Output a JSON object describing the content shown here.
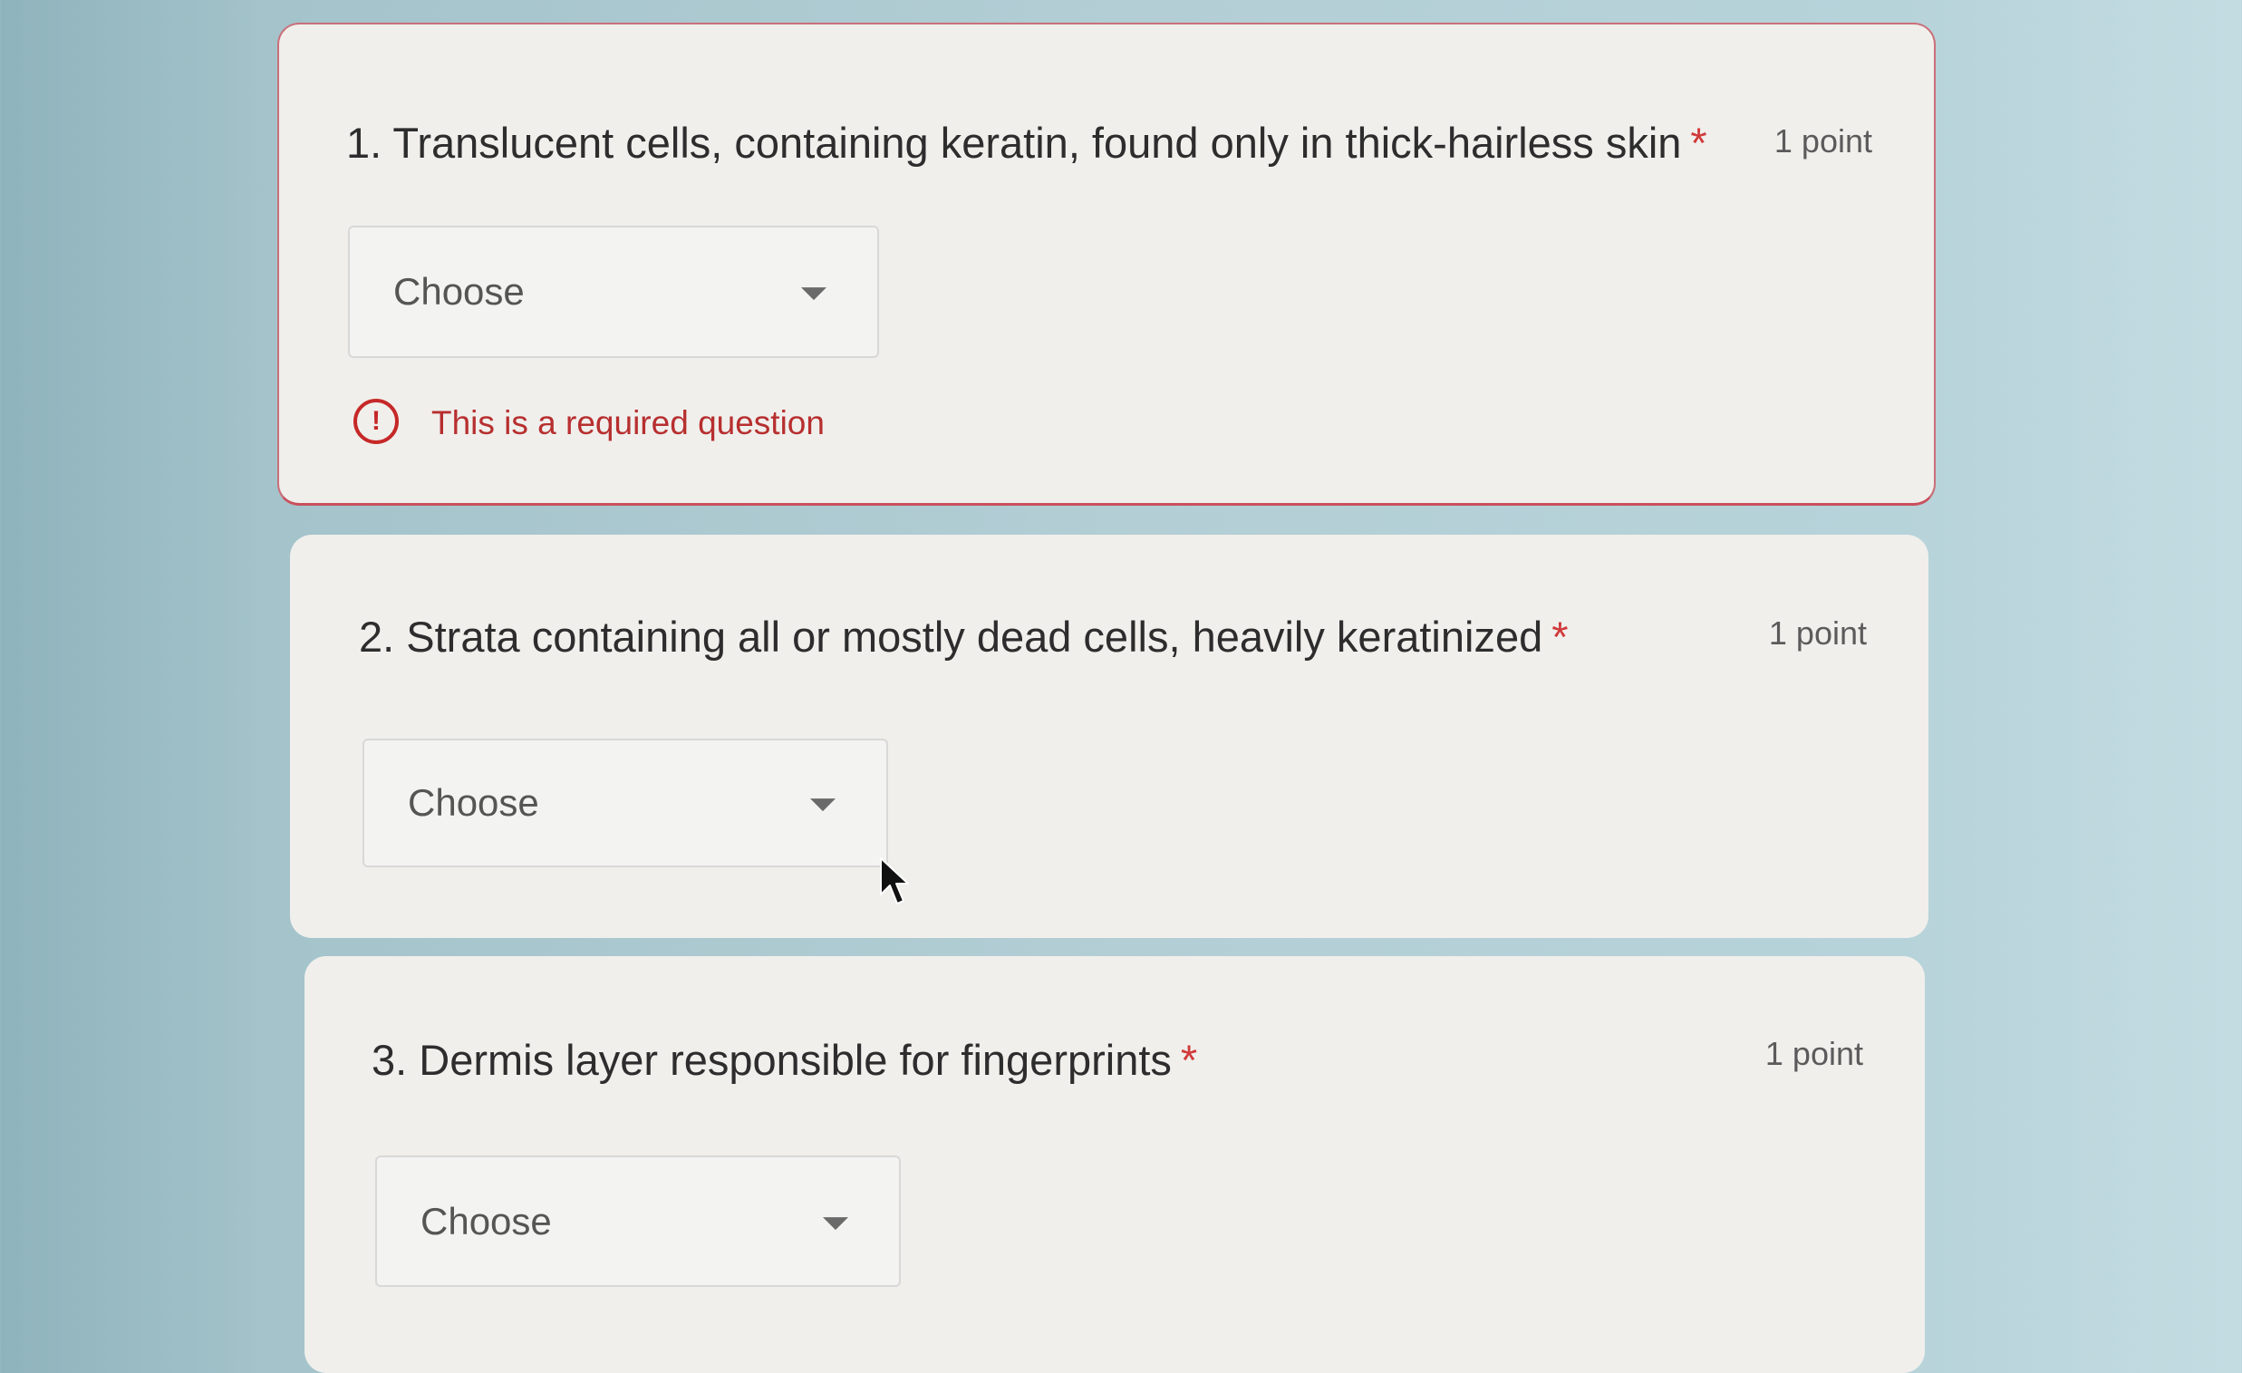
{
  "questions": [
    {
      "title": "1. Translucent cells, containing keratin, found only in thick-hairless skin",
      "required_marker": "*",
      "points": "1 point",
      "dropdown_value": "Choose",
      "error": "This is a required question",
      "error_icon": "alert-circle-icon"
    },
    {
      "title": "2. Strata containing all or mostly dead cells, heavily keratinized",
      "required_marker": "*",
      "points": "1 point",
      "dropdown_value": "Choose"
    },
    {
      "title": "3. Dermis layer responsible for fingerprints",
      "required_marker": "*",
      "points": "1 point",
      "dropdown_value": "Choose"
    }
  ],
  "colors": {
    "error": "#c62828",
    "required": "#d03a3a",
    "card_background": "#f0efec"
  },
  "pointer": "mouse-pointer-icon"
}
